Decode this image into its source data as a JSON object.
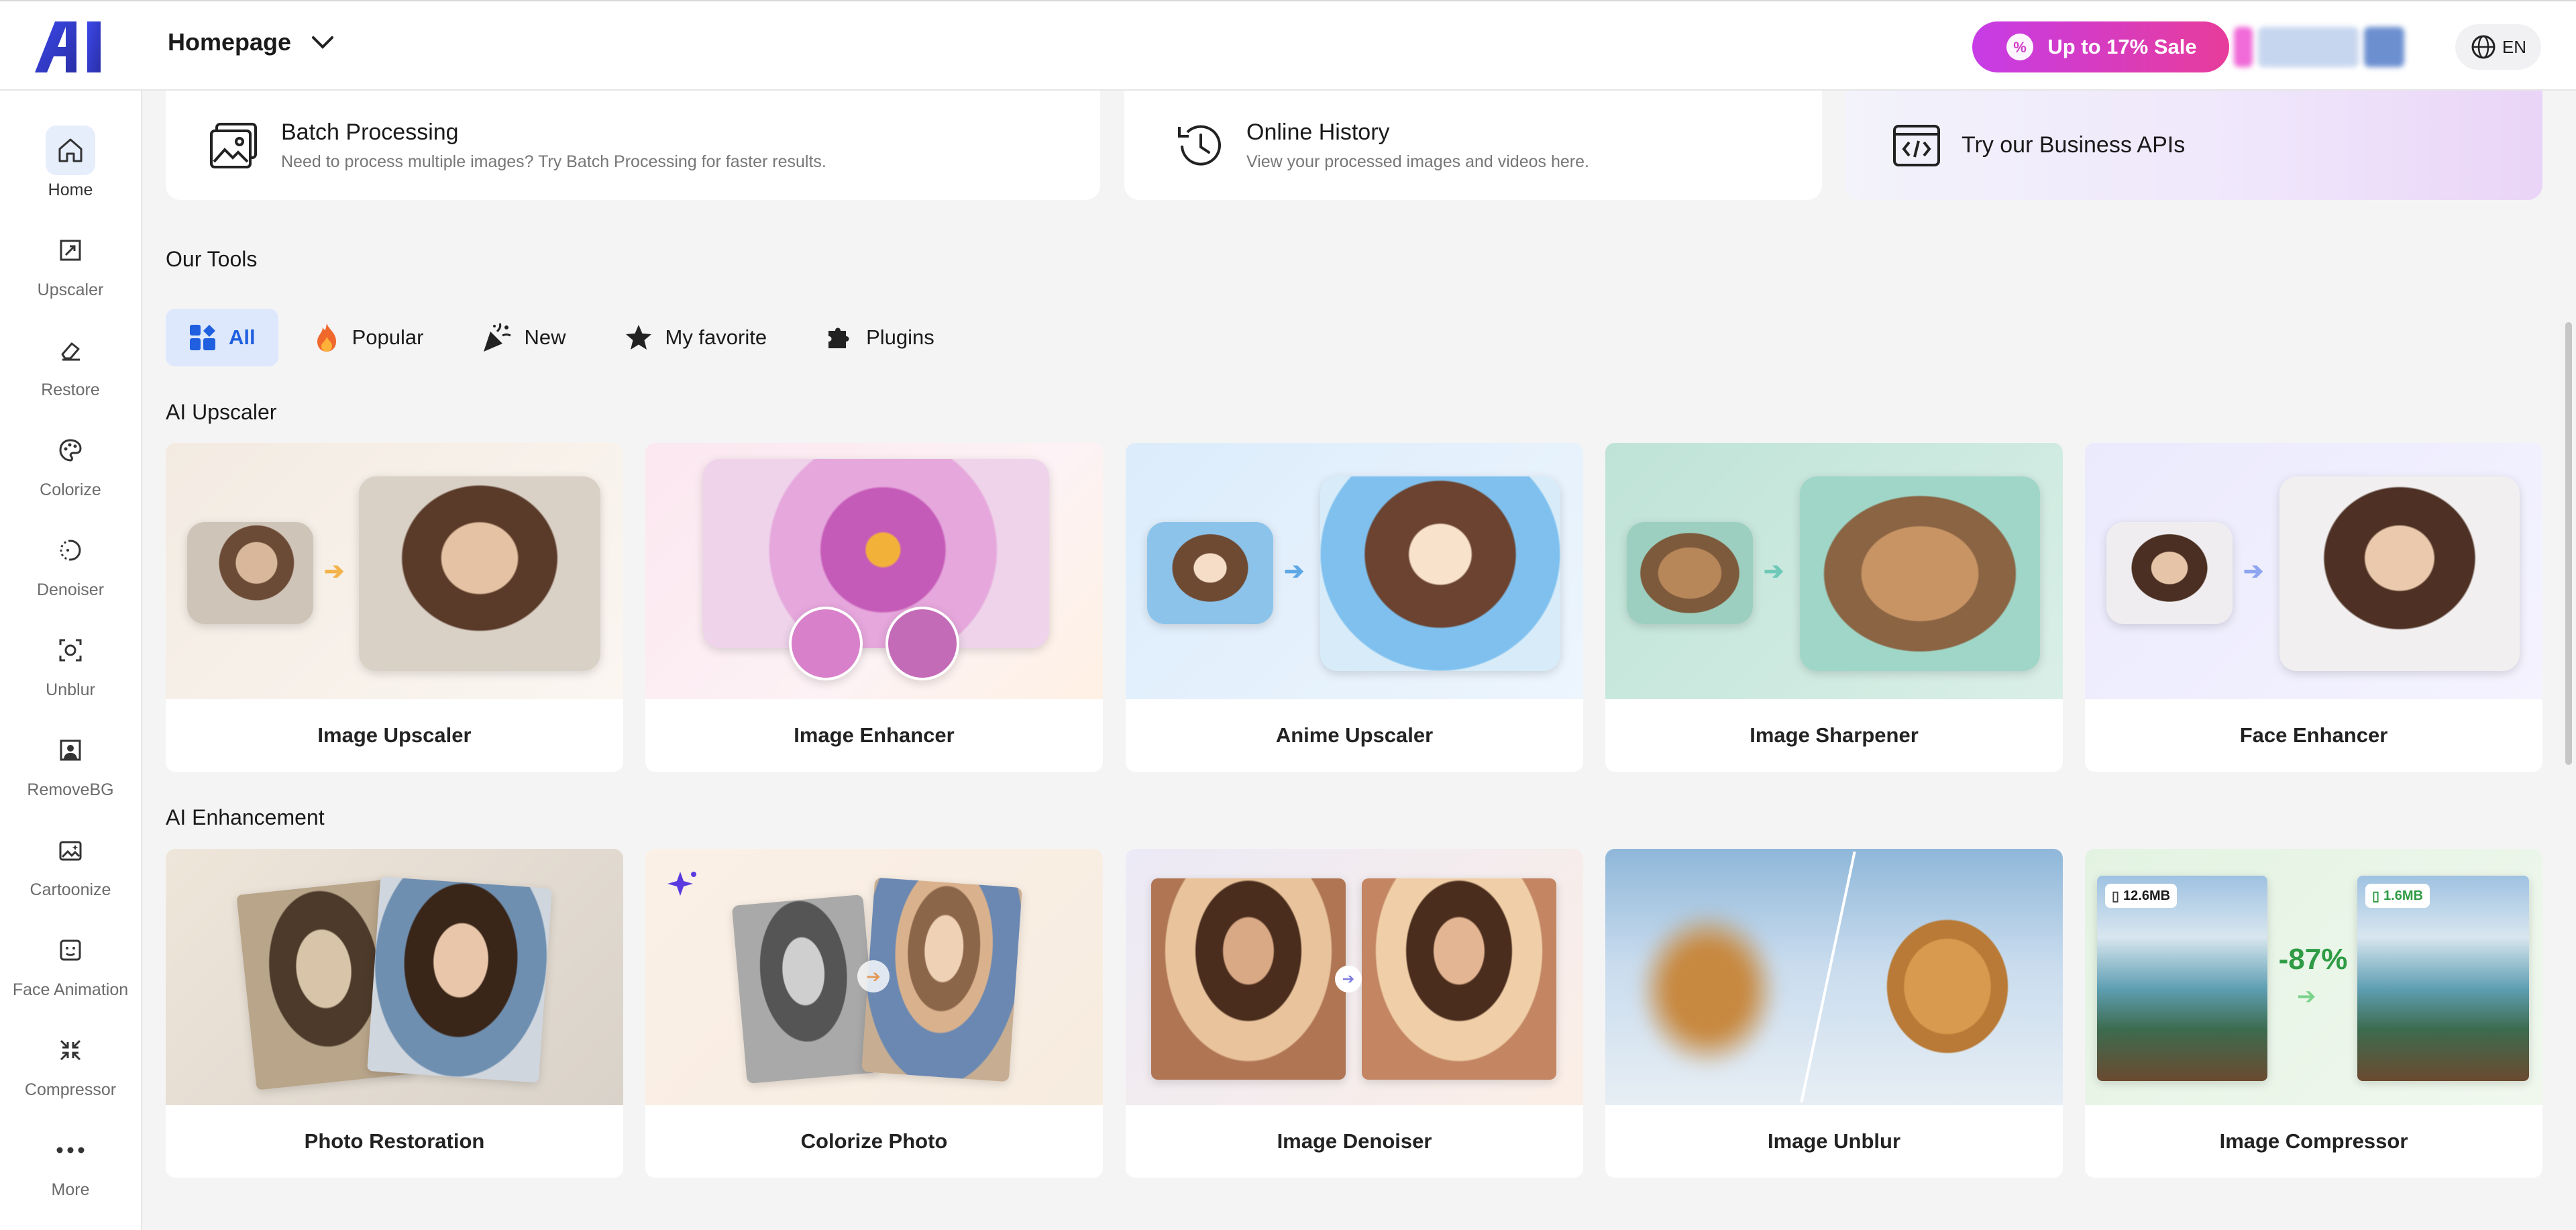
{
  "header": {
    "page_select_label": "Homepage",
    "sale_label": "Up to 17% Sale",
    "lang_label": "EN"
  },
  "sidebar": {
    "items": [
      {
        "label": "Home",
        "icon": "home-icon"
      },
      {
        "label": "Upscaler",
        "icon": "upscaler-icon"
      },
      {
        "label": "Restore",
        "icon": "eraser-icon"
      },
      {
        "label": "Colorize",
        "icon": "palette-icon"
      },
      {
        "label": "Denoiser",
        "icon": "denoise-icon"
      },
      {
        "label": "Unblur",
        "icon": "focus-icon"
      },
      {
        "label": "RemoveBG",
        "icon": "portrait-icon"
      },
      {
        "label": "Cartoonize",
        "icon": "image-sparkle-icon"
      },
      {
        "label": "Face Animation",
        "icon": "face-icon"
      },
      {
        "label": "Compressor",
        "icon": "compress-icon"
      },
      {
        "label": "More",
        "icon": "more-dots-icon"
      }
    ]
  },
  "top_cards": [
    {
      "title": "Batch Processing",
      "subtitle": "Need to process multiple images? Try Batch Processing for faster results.",
      "icon": "batch-images-icon"
    },
    {
      "title": "Online History",
      "subtitle": "View your processed images and videos here.",
      "icon": "history-icon"
    },
    {
      "title": "Try our Business APIs",
      "icon": "code-icon"
    }
  ],
  "tools": {
    "heading": "Our Tools",
    "filters": [
      {
        "label": "All",
        "icon": "grid-icon"
      },
      {
        "label": "Popular",
        "icon": "fire-icon"
      },
      {
        "label": "New",
        "icon": "party-icon"
      },
      {
        "label": "My favorite",
        "icon": "star-icon"
      },
      {
        "label": "Plugins",
        "icon": "puzzle-icon"
      }
    ]
  },
  "sections": [
    {
      "title": "AI Upscaler",
      "cards": [
        {
          "label": "Image Upscaler"
        },
        {
          "label": "Image Enhancer"
        },
        {
          "label": "Anime Upscaler"
        },
        {
          "label": "Image Sharpener"
        },
        {
          "label": "Face Enhancer"
        }
      ]
    },
    {
      "title": "AI Enhancement",
      "cards": [
        {
          "label": "Photo Restoration"
        },
        {
          "label": "Colorize Photo"
        },
        {
          "label": "Image Denoiser"
        },
        {
          "label": "Image Unblur"
        },
        {
          "label": "Image Compressor",
          "before_size": "12.6MB",
          "after_size": "1.6MB",
          "reduction": "-87%"
        }
      ]
    }
  ],
  "colors": {
    "accent": "#1f5fe0",
    "sale_gradient_start": "#c63ce6",
    "sale_gradient_end": "#e73c9b"
  }
}
